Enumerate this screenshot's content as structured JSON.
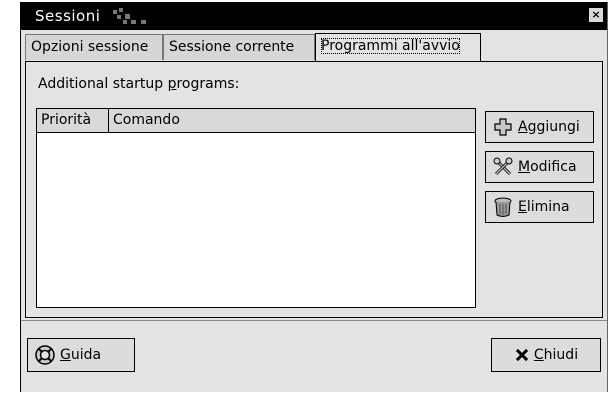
{
  "window": {
    "title": "Sessioni",
    "close_glyph": "×"
  },
  "tabs": [
    {
      "label": "Opzioni sessione",
      "active": false
    },
    {
      "label": "Sessione corrente",
      "active": false
    },
    {
      "label": "Programmi all'avvio",
      "active": true
    }
  ],
  "panel": {
    "label_prefix": "Additional startup ",
    "label_mnemonic": "p",
    "label_suffix": "rograms:",
    "list": {
      "columns": [
        "Priorità",
        "Comando"
      ],
      "rows": []
    },
    "buttons": [
      {
        "mnemonic": "A",
        "rest": "ggiungi",
        "icon": "plus-icon"
      },
      {
        "mnemonic": "M",
        "rest": "odifica",
        "icon": "tools-icon"
      },
      {
        "mnemonic": "E",
        "rest": "limina",
        "icon": "trash-icon"
      }
    ]
  },
  "footer": {
    "help": {
      "mnemonic": "G",
      "rest": "uida",
      "icon": "lifebuoy-icon"
    },
    "close": {
      "mnemonic": "C",
      "rest": "hiudi",
      "icon": "close-x-icon"
    }
  }
}
